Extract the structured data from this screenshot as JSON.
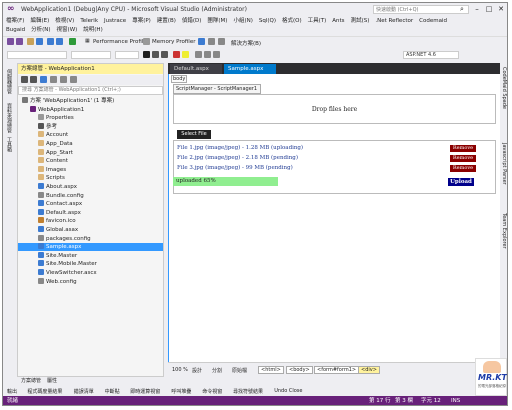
{
  "window": {
    "title": "WebApplication1 (Debug|Any CPU) - Microsoft Visual Studio (Administrator)",
    "quick_launch_placeholder": "快速啟動 (Ctrl+Q)",
    "min": "–",
    "max": "□",
    "close": "✕"
  },
  "menu_row1": [
    "檔案(F)",
    "編輯(E)",
    "檢視(V)",
    "Telerik",
    "Justrace",
    "專案(P)",
    "建置(B)",
    "偵錯(D)",
    "團隊(M)",
    "小組(N)",
    "Sql(Q)",
    "格式(O)",
    "工具(T)",
    "Ants",
    "測試(S)",
    ".Net Reflector",
    "Codemaid"
  ],
  "menu_row2": [
    "Bugaid",
    "分析(N)",
    "視窗(W)",
    "說明(H)"
  ],
  "toolbar": {
    "perf_profiler": "Performance Profiler",
    "memory_profiler": "Memory Profiler",
    "solution_mgmt": "解決方案(B)",
    "config_select": "ASP.NET 4.6"
  },
  "left_tabs": [
    "伺服器總管",
    "資料來源總管",
    "工具箱"
  ],
  "solution_explorer": {
    "title": "方案總管 - WebApplication1",
    "search_placeholder": "搜尋 方案總管 - WebApplication1 (Ctrl+;)",
    "items": [
      {
        "label": "方案 'WebApplication1' (1 專案)",
        "indent": 0,
        "color": "#777"
      },
      {
        "label": "WebApplication1",
        "indent": 1,
        "color": "#68217a"
      },
      {
        "label": "Properties",
        "indent": 2,
        "color": "#999"
      },
      {
        "label": "參考",
        "indent": 2,
        "color": "#555"
      },
      {
        "label": "Account",
        "indent": 2,
        "color": "#dcb67a"
      },
      {
        "label": "App_Data",
        "indent": 2,
        "color": "#dcb67a"
      },
      {
        "label": "App_Start",
        "indent": 2,
        "color": "#dcb67a"
      },
      {
        "label": "Content",
        "indent": 2,
        "color": "#dcb67a"
      },
      {
        "label": "Images",
        "indent": 2,
        "color": "#dcb67a"
      },
      {
        "label": "Scripts",
        "indent": 2,
        "color": "#dcb67a"
      },
      {
        "label": "About.aspx",
        "indent": 2,
        "color": "#3c7bd1"
      },
      {
        "label": "Bundle.config",
        "indent": 2,
        "color": "#888"
      },
      {
        "label": "Contact.aspx",
        "indent": 2,
        "color": "#3c7bd1"
      },
      {
        "label": "Default.aspx",
        "indent": 2,
        "color": "#3c7bd1"
      },
      {
        "label": "favicon.ico",
        "indent": 2,
        "color": "#c08030"
      },
      {
        "label": "Global.asax",
        "indent": 2,
        "color": "#3c7bd1"
      },
      {
        "label": "packages.config",
        "indent": 2,
        "color": "#888"
      },
      {
        "label": "Sample.aspx",
        "indent": 2,
        "color": "#3c7bd1"
      },
      {
        "label": "Site.Master",
        "indent": 2,
        "color": "#3c7bd1"
      },
      {
        "label": "Site.Mobile.Master",
        "indent": 2,
        "color": "#3c7bd1"
      },
      {
        "label": "ViewSwitcher.ascx",
        "indent": 2,
        "color": "#3c7bd1"
      },
      {
        "label": "Web.config",
        "indent": 2,
        "color": "#888"
      }
    ],
    "selected_index": 17,
    "bottom_tabs": [
      "方案總管",
      "屬性"
    ]
  },
  "editor": {
    "tabs": [
      "Default.aspx",
      "Sample.aspx"
    ],
    "active_tab": 1,
    "body_tag": "body",
    "script_manager": "ScriptManager - ScriptManager1",
    "drop_text": "Drop files here",
    "select_file": "Select File",
    "files": [
      {
        "text": "File 1.jpg (image/jpeg) - 1.28 MB (uploading)",
        "remove": "Remove"
      },
      {
        "text": "File 2.jpg (image/jpeg) - 2.18 MB (pending)",
        "remove": "Remove"
      },
      {
        "text": "File 3.jpg (image/jpeg) - 99 MB (pending)",
        "remove": "Remove"
      }
    ],
    "progress_text": "uploaded 65%",
    "progress_fraction": 0.65,
    "upload_label": "Upload",
    "view_buttons": [
      "設計",
      "分割",
      "原始檔"
    ],
    "breadcrumbs": [
      "<html>",
      "<body>",
      "<form#form1>",
      "<div>"
    ],
    "zoom": "100 %"
  },
  "right_tabs": [
    "CodeMaid Spade",
    "Javascript Parser",
    "Team Explorer"
  ],
  "output_tabs": [
    "輸出",
    "程式碼度量結果",
    "錯誤清單",
    "中斷點",
    "即時運算視窗",
    "呼叫堆疊",
    "命令視窗",
    "尋找符號結果",
    "Undo Close"
  ],
  "status": {
    "ready": "就緒",
    "line": "第 17 行",
    "col": "第 3 欄",
    "ch": "字元 12",
    "ins": "INS"
  },
  "watermark": {
    "brand": "MR.KT",
    "sub": "的電光部落格紀錄"
  }
}
